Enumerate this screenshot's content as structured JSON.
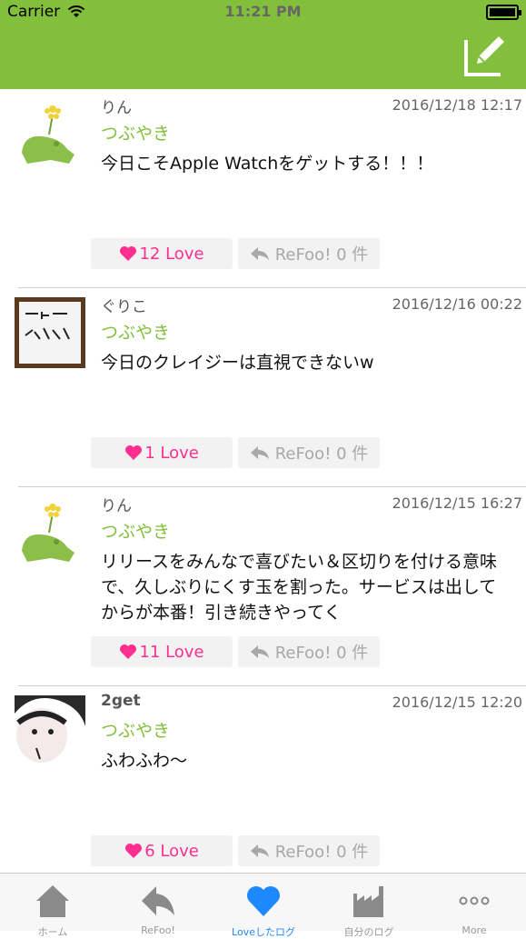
{
  "status_bar": {
    "carrier": "Carrier",
    "time": "11:21 PM"
  },
  "colors": {
    "accent": "#82c03b",
    "love": "#ff2f8f",
    "tab_active": "#1e88ff"
  },
  "posts": [
    {
      "username": "りん",
      "time": "2016/12/18 12:17",
      "category": "つぶやき",
      "content": "今日こそApple Watchをゲットする！！！",
      "love": "12 Love",
      "refoo": "ReFoo! 0 件"
    },
    {
      "username": "ぐりこ",
      "time": "2016/12/16 00:22",
      "category": "つぶやき",
      "content": "今日のクレイジーは直視できないw",
      "love": "1 Love",
      "refoo": "ReFoo! 0 件"
    },
    {
      "username": "りん",
      "time": "2016/12/15 16:27",
      "category": "つぶやき",
      "content": "リリースをみんなで喜びたい＆区切りを付ける意味で、久しぶりにくす玉を割った。サービスは出してからが本番！引き続きやってく",
      "love": "11 Love",
      "refoo": "ReFoo! 0 件"
    },
    {
      "username": "2get",
      "time": "2016/12/15 12:20",
      "category": "つぶやき",
      "content": "ふわふわ〜",
      "love": "6 Love",
      "refoo": "ReFoo! 0 件"
    }
  ],
  "tabbar": {
    "tabs": [
      {
        "icon": "home-icon",
        "label": "ホーム"
      },
      {
        "icon": "reply-icon",
        "label": "ReFoo!"
      },
      {
        "icon": "heart-icon",
        "label": "Loveしたログ"
      },
      {
        "icon": "factory-icon",
        "label": "自分のログ"
      },
      {
        "icon": "more-icon",
        "label": "More"
      }
    ]
  }
}
